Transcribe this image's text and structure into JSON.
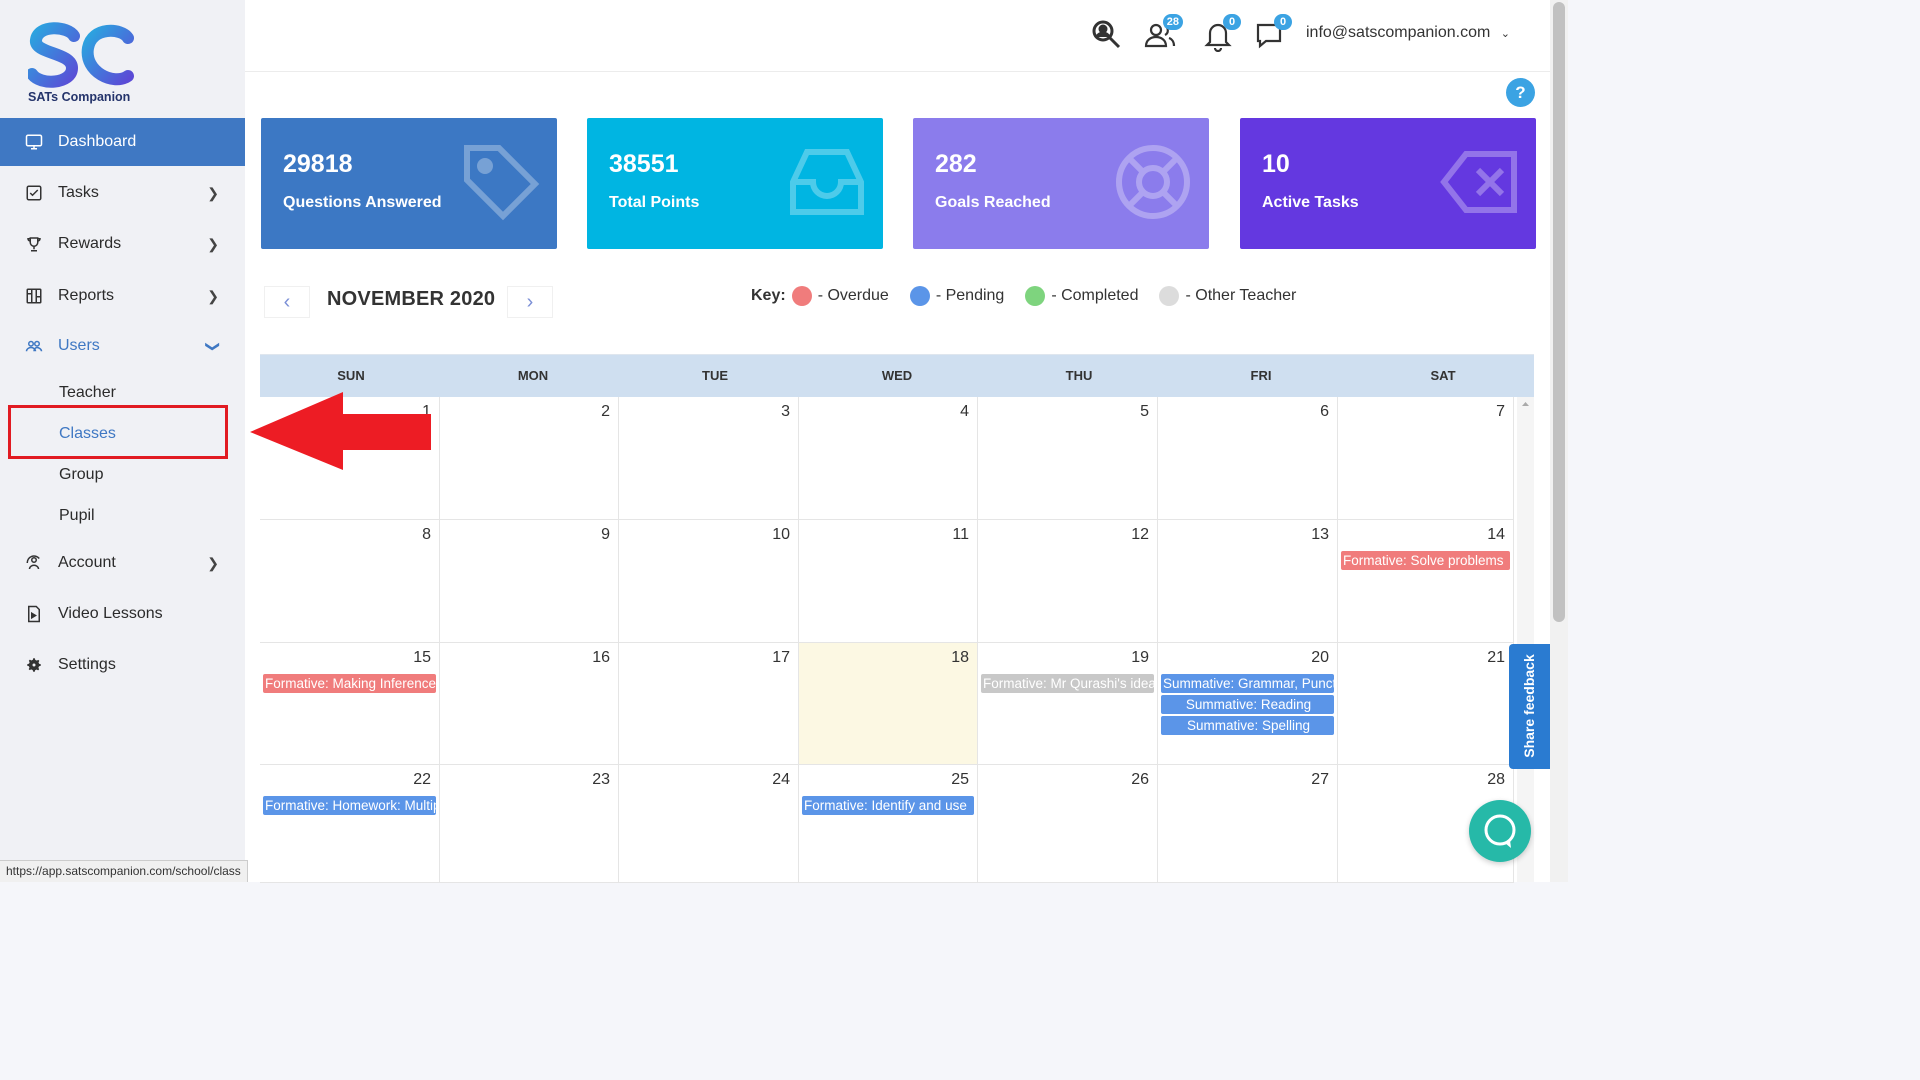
{
  "app": {
    "brand": "SATs Companion",
    "logo_text": "SC"
  },
  "sidebar": {
    "items": [
      {
        "label": "Dashboard",
        "icon": "monitor-icon"
      },
      {
        "label": "Tasks",
        "icon": "task-icon"
      },
      {
        "label": "Rewards",
        "icon": "trophy-icon"
      },
      {
        "label": "Reports",
        "icon": "report-icon"
      },
      {
        "label": "Users",
        "icon": "users-icon"
      },
      {
        "label": "Account",
        "icon": "account-icon"
      },
      {
        "label": "Video Lessons",
        "icon": "video-icon"
      },
      {
        "label": "Settings",
        "icon": "gear-icon"
      }
    ],
    "users_sub": [
      "Teacher",
      "Classes",
      "Group",
      "Pupil"
    ]
  },
  "status_url": "https://app.satscompanion.com/school/class",
  "topbar": {
    "badges": {
      "users": "28",
      "notifications": "0",
      "messages": "0"
    },
    "user_email": "info@satscompanion.com"
  },
  "help_label": "?",
  "stats": [
    {
      "value": "29818",
      "label": "Questions Answered",
      "color": "#3c78c4",
      "icon": "tag-icon"
    },
    {
      "value": "38551",
      "label": "Total Points",
      "color": "#00b5e2",
      "icon": "inbox-icon"
    },
    {
      "value": "282",
      "label": "Goals Reached",
      "color": "#8b7cec",
      "icon": "lifebuoy-icon"
    },
    {
      "value": "10",
      "label": "Active Tasks",
      "color": "#6438e0",
      "icon": "delete-icon"
    }
  ],
  "calendar": {
    "month_title": "NOVEMBER 2020",
    "prev": "‹",
    "next": "›",
    "key_label": "Key:",
    "legend": [
      {
        "label": "- Overdue",
        "color": "#f07c7c"
      },
      {
        "label": "- Pending",
        "color": "#5b95e8"
      },
      {
        "label": "- Completed",
        "color": "#7ed47e"
      },
      {
        "label": "- Other Teacher",
        "color": "#dcdcdc"
      }
    ],
    "weekdays": [
      "SUN",
      "MON",
      "TUE",
      "WED",
      "THU",
      "FRI",
      "SAT"
    ],
    "weeks": [
      [
        "1",
        "2",
        "3",
        "4",
        "5",
        "6",
        "7"
      ],
      [
        "8",
        "9",
        "10",
        "11",
        "12",
        "13",
        "14"
      ],
      [
        "15",
        "16",
        "17",
        "18",
        "19",
        "20",
        "21"
      ],
      [
        "22",
        "23",
        "24",
        "25",
        "26",
        "27",
        "28"
      ]
    ],
    "events": {
      "w1d6": [
        {
          "title": "Formative: Solve problems",
          "type": "overdue"
        }
      ],
      "w2d0": [
        {
          "title": "Formative: Making Inferences",
          "type": "overdue"
        }
      ],
      "w2d4": [
        {
          "title": "Formative: Mr Qurashi's idea",
          "type": "other"
        }
      ],
      "w2d5": [
        {
          "title": "Summative: Grammar, Punctuation",
          "type": "pending"
        },
        {
          "title": "Summative: Reading",
          "type": "pending",
          "center": true
        },
        {
          "title": "Summative: Spelling",
          "type": "pending",
          "center": true
        }
      ],
      "w3d0": [
        {
          "title": "Formative: Homework: Multiply",
          "type": "pending"
        }
      ],
      "w3d3": [
        {
          "title": "Formative: Identify and use",
          "type": "pending"
        }
      ]
    }
  },
  "feedback_label": "Share feedback"
}
